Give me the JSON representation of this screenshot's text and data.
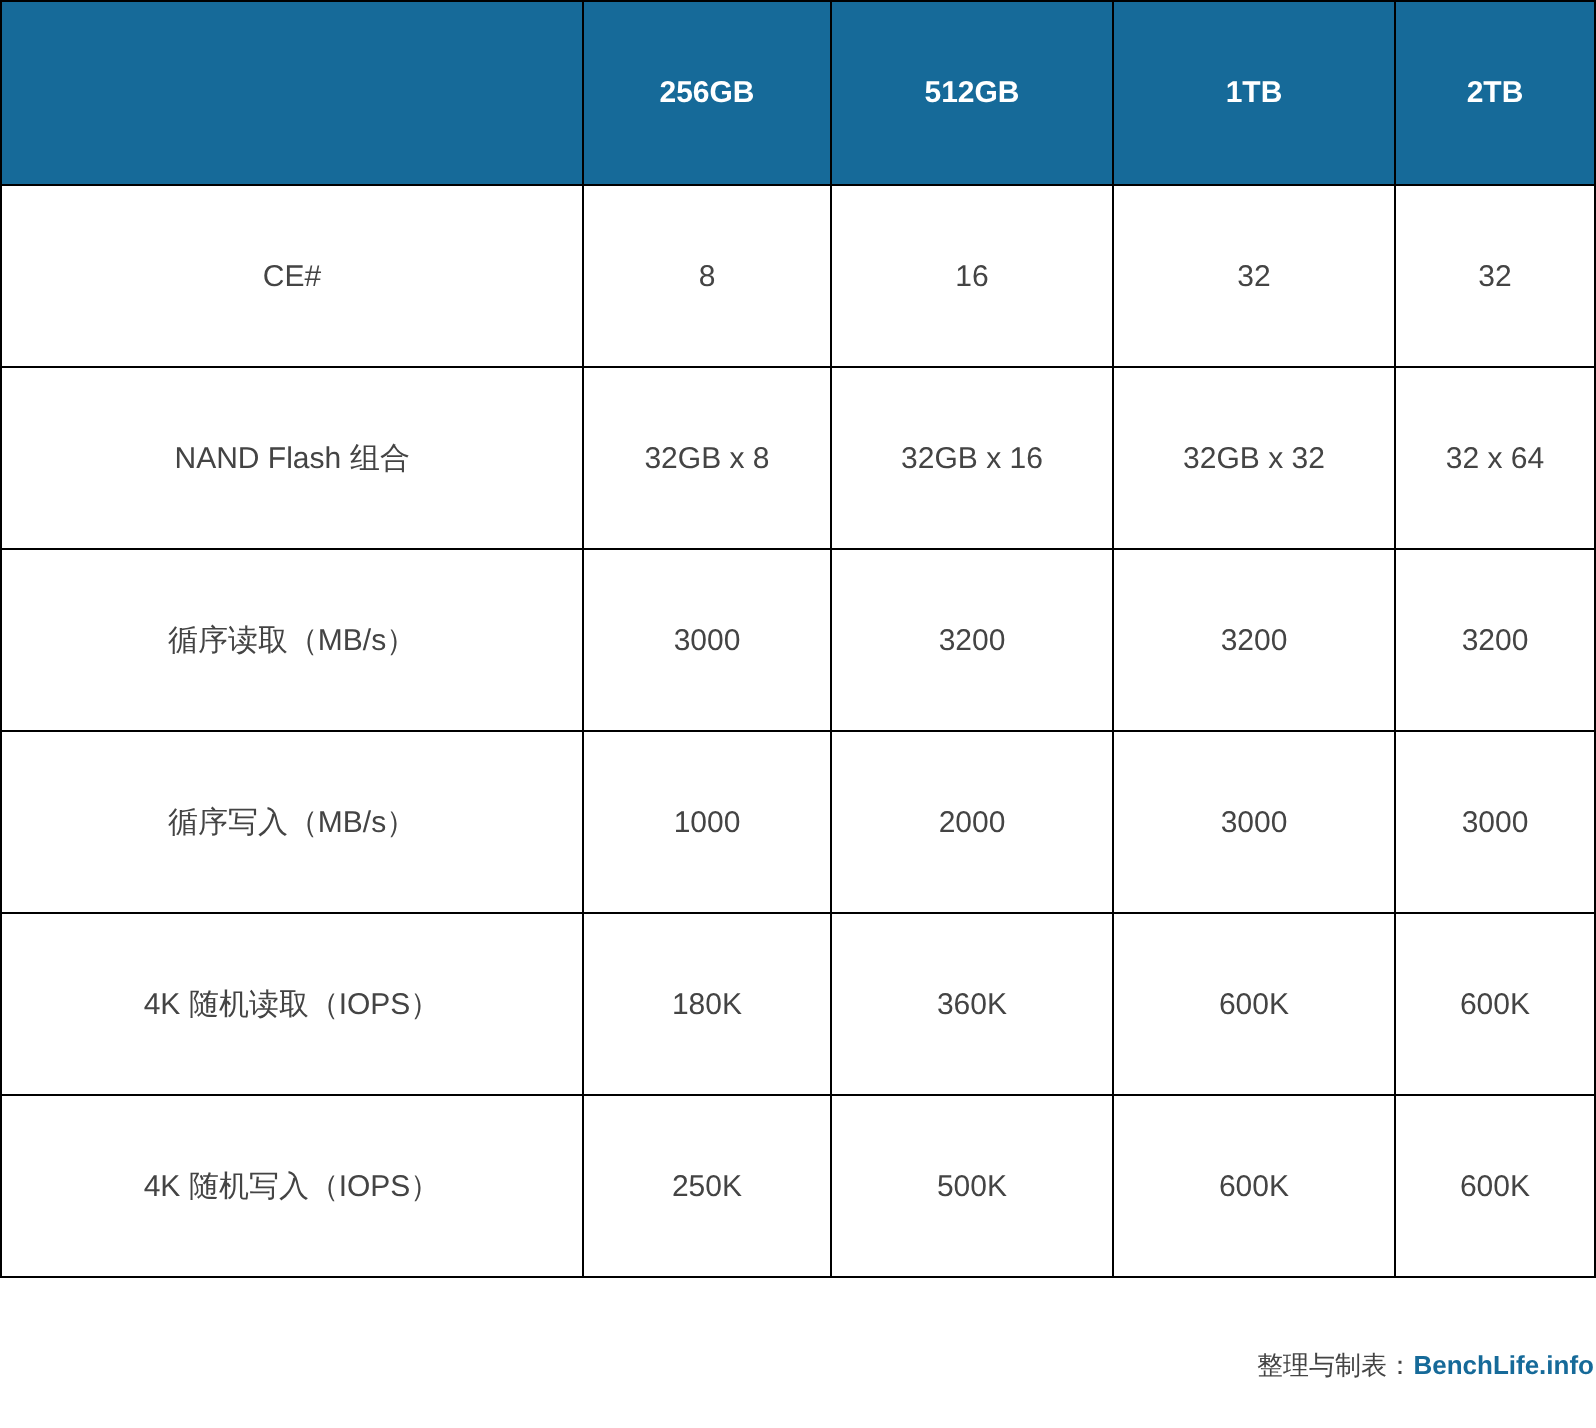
{
  "table": {
    "columns": [
      "256GB",
      "512GB",
      "1TB",
      "2TB"
    ],
    "rows": [
      {
        "label": "CE#",
        "cells": [
          "8",
          "16",
          "32",
          "32"
        ]
      },
      {
        "label": "NAND Flash 组合",
        "cells": [
          "32GB x 8",
          "32GB x 16",
          "32GB x 32",
          "32 x 64"
        ]
      },
      {
        "label": "循序读取（MB/s）",
        "cells": [
          "3000",
          "3200",
          "3200",
          "3200"
        ]
      },
      {
        "label": "循序写入（MB/s）",
        "cells": [
          "1000",
          "2000",
          "3000",
          "3000"
        ]
      },
      {
        "label": "4K 随机读取（IOPS）",
        "cells": [
          "180K",
          "360K",
          "600K",
          "600K"
        ]
      },
      {
        "label": "4K 随机写入（IOPS）",
        "cells": [
          "250K",
          "500K",
          "600K",
          "600K"
        ]
      }
    ]
  },
  "credit": {
    "label": "整理与制表：",
    "link": "BenchLife.info"
  }
}
